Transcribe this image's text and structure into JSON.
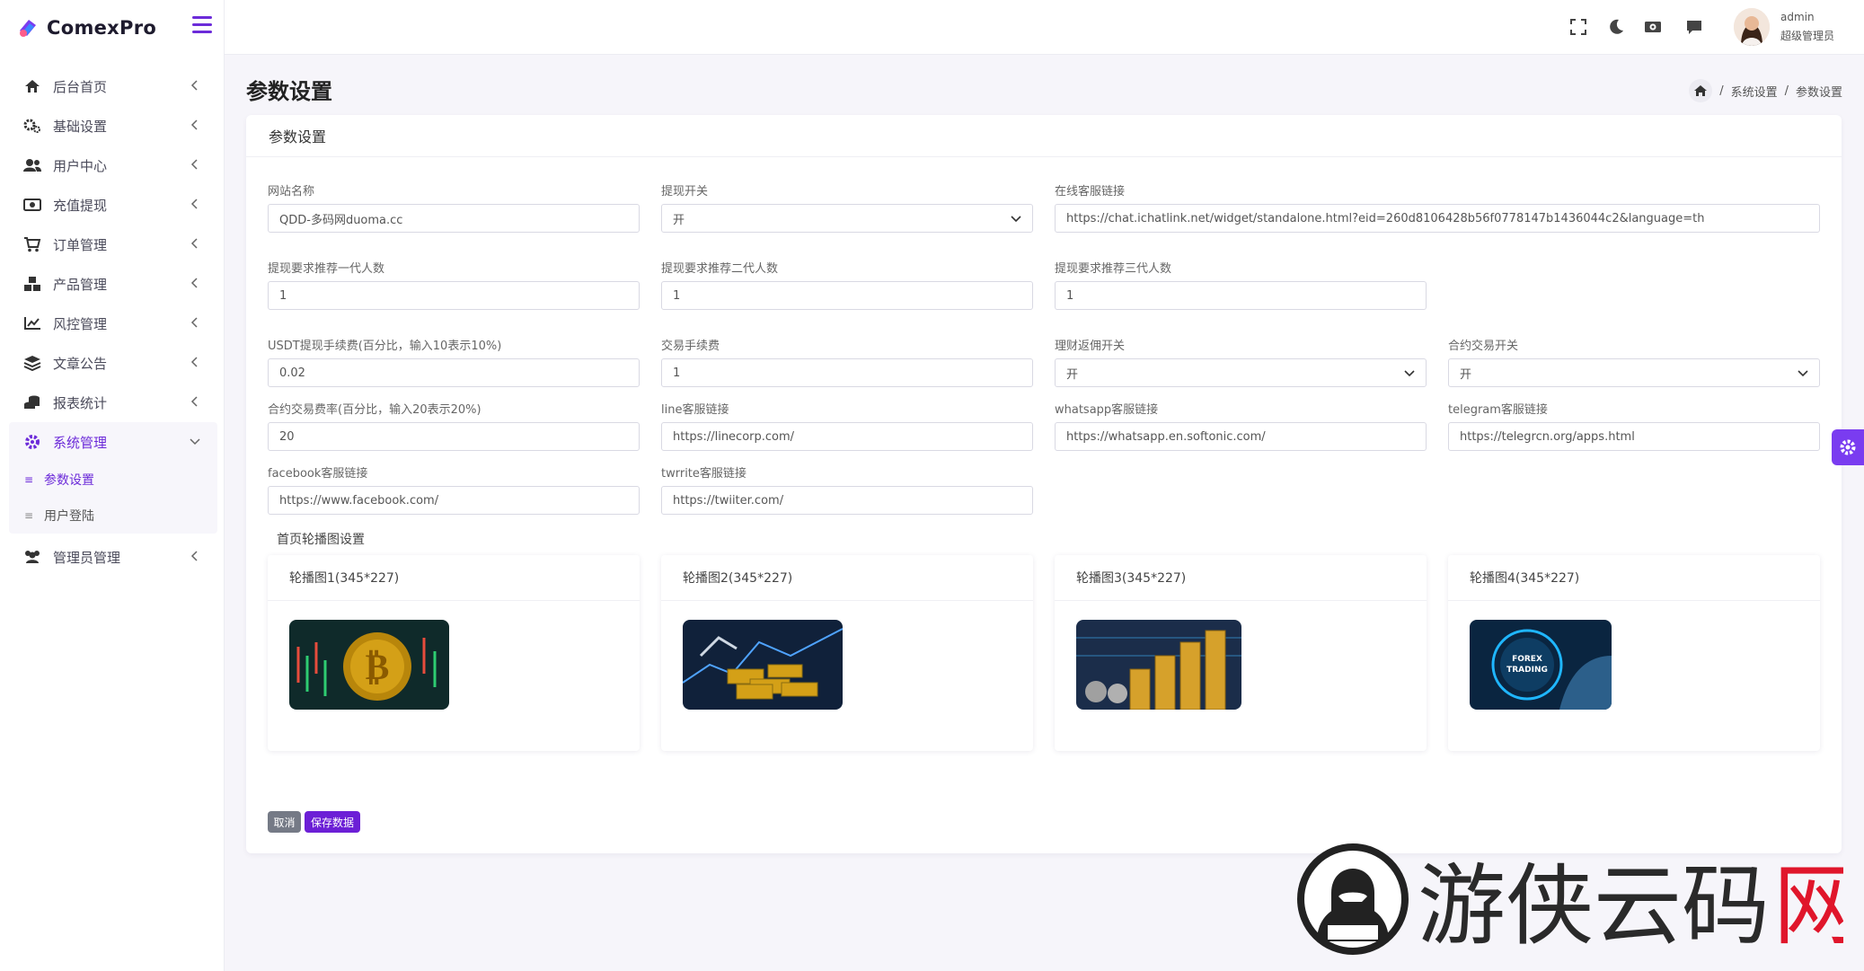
{
  "app": {
    "name": "ComexPro"
  },
  "sidebar": {
    "items": [
      {
        "label": "后台首页",
        "icon": "home-icon"
      },
      {
        "label": "基础设置",
        "icon": "gears-icon"
      },
      {
        "label": "用户中心",
        "icon": "users-icon"
      },
      {
        "label": "充值提现",
        "icon": "money-icon"
      },
      {
        "label": "订单管理",
        "icon": "cart-icon"
      },
      {
        "label": "产品管理",
        "icon": "cubes-icon"
      },
      {
        "label": "风控管理",
        "icon": "chart-line-icon"
      },
      {
        "label": "文章公告",
        "icon": "layers-icon"
      },
      {
        "label": "报表统计",
        "icon": "coins-icon"
      }
    ],
    "system": {
      "label": "系统管理",
      "sub": [
        "参数设置",
        "用户登陆"
      ]
    },
    "admin_item": {
      "label": "管理员管理"
    }
  },
  "topbar": {
    "user_name": "admin",
    "user_role": "超级管理员"
  },
  "page": {
    "title": "参数设置",
    "breadcrumb": [
      "系统设置",
      "参数设置"
    ]
  },
  "card": {
    "title": "参数设置"
  },
  "form": {
    "site_name": {
      "label": "网站名称",
      "value": "QDD-多码网duoma.cc"
    },
    "withdraw_switch": {
      "label": "提现开关",
      "value": "开"
    },
    "service_link": {
      "label": "在线客服链接",
      "value": "https://chat.ichatlink.net/widget/standalone.html?eid=260d8106428b56f0778147b1436044c2&language=th"
    },
    "req_gen1": {
      "label": "提现要求推荐一代人数",
      "value": "1"
    },
    "req_gen2": {
      "label": "提现要求推荐二代人数",
      "value": "1"
    },
    "req_gen3": {
      "label": "提现要求推荐三代人数",
      "value": "1"
    },
    "usdt_fee": {
      "label": "USDT提现手续费(百分比，输入10表示10%)",
      "value": "0.02"
    },
    "trade_fee": {
      "label": "交易手续费",
      "value": "1"
    },
    "finance_rebate": {
      "label": "理财返佣开关",
      "value": "开"
    },
    "contract_switch": {
      "label": "合约交易开关",
      "value": "开"
    },
    "contract_rate": {
      "label": "合约交易费率(百分比，输入20表示20%)",
      "value": "20"
    },
    "line_link": {
      "label": "line客服链接",
      "value": "https://linecorp.com/"
    },
    "whatsapp_link": {
      "label": "whatsapp客服链接",
      "value": "https://whatsapp.en.softonic.com/"
    },
    "telegram_link": {
      "label": "telegram客服链接",
      "value": "https://telegrcn.org/apps.html"
    },
    "facebook_link": {
      "label": "facebook客服链接",
      "value": "https://www.facebook.com/"
    },
    "twitter_link": {
      "label": "twrrite客服链接",
      "value": "https://twiiter.com/"
    }
  },
  "banners": {
    "section_label": "首页轮播图设置",
    "items": [
      {
        "title": "轮播图1(345*227)"
      },
      {
        "title": "轮播图2(345*227)"
      },
      {
        "title": "轮播图3(345*227)"
      },
      {
        "title": "轮播图4(345*227)",
        "image_text": "FOREX TRADING"
      }
    ]
  },
  "buttons": {
    "cancel": "取消",
    "save": "保存数据"
  },
  "watermark": {
    "text": "游侠云码网"
  },
  "colors": {
    "accent": "#6c1fd6",
    "cancel": "#757a86"
  }
}
